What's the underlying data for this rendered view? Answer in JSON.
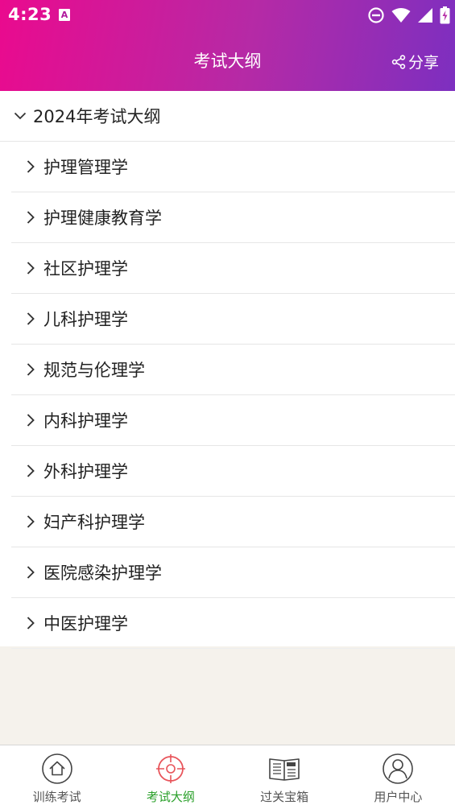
{
  "status": {
    "time": "4:23",
    "a_icon": "A"
  },
  "header": {
    "title": "考试大纲",
    "share_label": "分享"
  },
  "section": {
    "title": "2024年考试大纲"
  },
  "items": [
    {
      "label": "护理管理学"
    },
    {
      "label": "护理健康教育学"
    },
    {
      "label": "社区护理学"
    },
    {
      "label": "儿科护理学"
    },
    {
      "label": "规范与伦理学"
    },
    {
      "label": "内科护理学"
    },
    {
      "label": "外科护理学"
    },
    {
      "label": "妇产科护理学"
    },
    {
      "label": "医院感染护理学"
    },
    {
      "label": "中医护理学"
    }
  ],
  "tabs": [
    {
      "label": "训练考试",
      "icon": "home-icon",
      "active": false
    },
    {
      "label": "考试大纲",
      "icon": "target-icon",
      "active": true
    },
    {
      "label": "过关宝箱",
      "icon": "news-book-icon",
      "active": false
    },
    {
      "label": "用户中心",
      "icon": "user-icon",
      "active": false
    }
  ],
  "colors": {
    "accent_start": "#ea0a8e",
    "accent_end": "#7d2fc0",
    "active_tab": "#2aa02a",
    "active_icon": "#e8545a"
  }
}
